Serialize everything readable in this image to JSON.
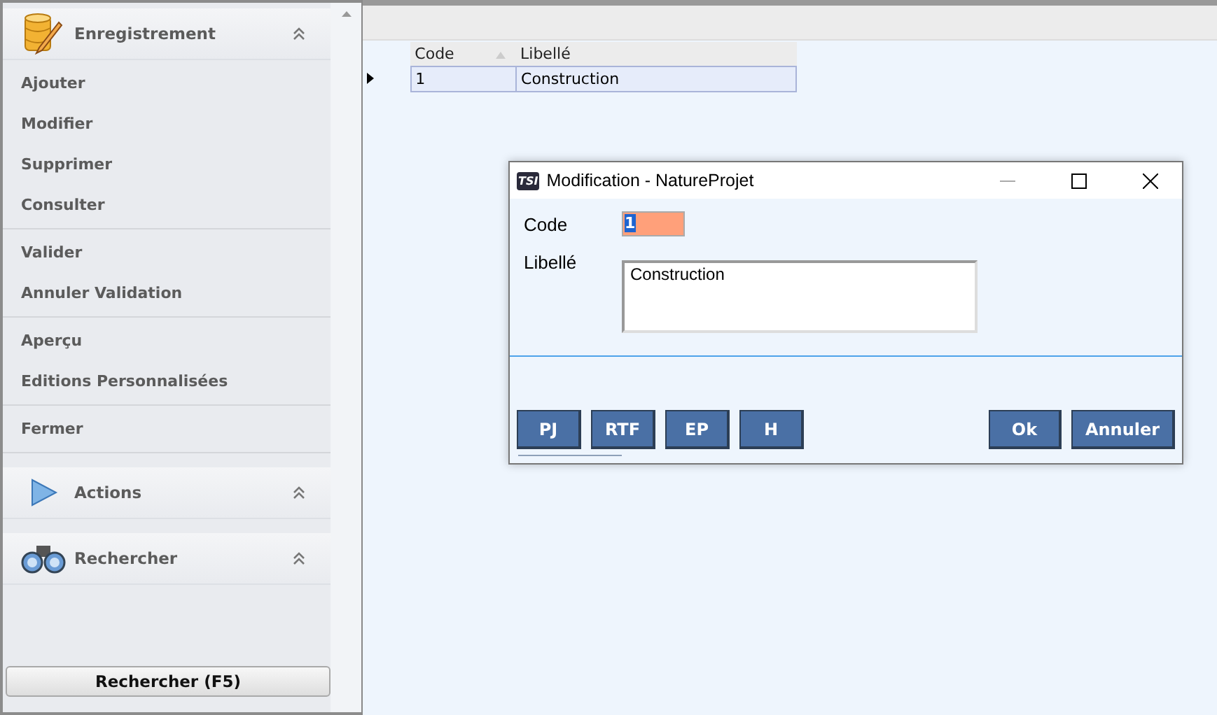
{
  "sidebar": {
    "sections": [
      {
        "kind": "records",
        "title": "Enregistrement",
        "groups": [
          [
            "Ajouter",
            "Modifier",
            "Supprimer",
            "Consulter"
          ],
          [
            "Valider",
            "Annuler Validation"
          ],
          [
            "Aperçu",
            "Editions Personnalisées"
          ],
          [
            "Fermer"
          ]
        ]
      },
      {
        "kind": "actions",
        "title": "Actions"
      },
      {
        "kind": "search",
        "title": "Rechercher"
      }
    ],
    "search_button": "Rechercher (F5)"
  },
  "grid": {
    "columns": [
      {
        "label": "Code",
        "sorted": true
      },
      {
        "label": "Libellé",
        "sorted": false
      }
    ],
    "rows": [
      {
        "cells": [
          "1",
          "Construction"
        ],
        "selected": true
      }
    ]
  },
  "dialog": {
    "app_badge": "TSI",
    "title": "Modification - NatureProjet",
    "fields": [
      {
        "kind": "code",
        "label": "Code",
        "value": "1"
      },
      {
        "kind": "text",
        "label": "Libellé",
        "value": "Construction"
      }
    ],
    "left_buttons": [
      "PJ",
      "RTF",
      "EP",
      "H"
    ],
    "right_buttons": [
      "Ok",
      "Annuler"
    ]
  }
}
